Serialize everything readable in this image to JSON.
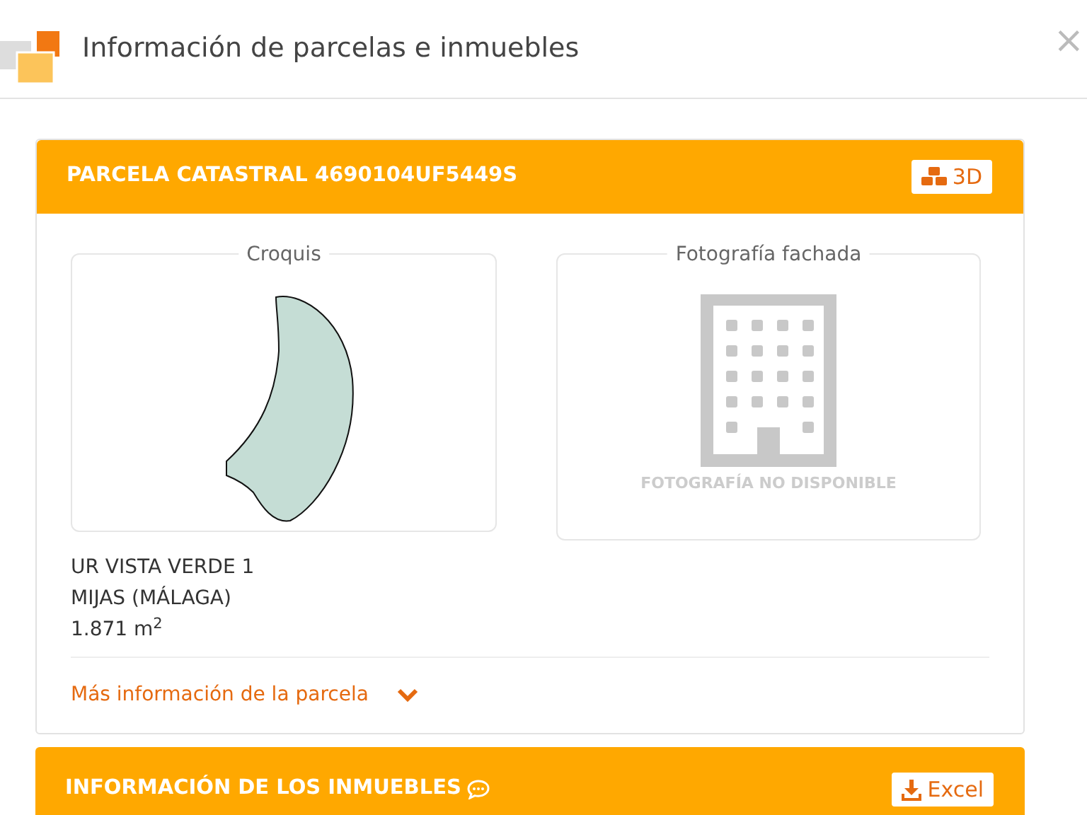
{
  "window": {
    "title": "Información de parcelas e inmuebles",
    "close": "×"
  },
  "parcel": {
    "title": "PARCELA CATASTRAL 4690104UF5449S",
    "button": "3D",
    "sketch": {
      "legend": "Croquis"
    },
    "photo": {
      "legend": "Fotografía fachada",
      "message": "FOTOGRAFÍA NO DISPONIBLE"
    },
    "address": [
      "UR VISTA VERDE 1",
      "MIJAS (MÁLAGA)",
      "1.871 m$^{2}$"
    ],
    "more_link": {
      "label": "Más información de la parcela",
      "expanded": false
    }
  },
  "properties": {
    "title": "INFORMACIÓN DE LOS INMUEBLES",
    "button": "Excel"
  }
}
